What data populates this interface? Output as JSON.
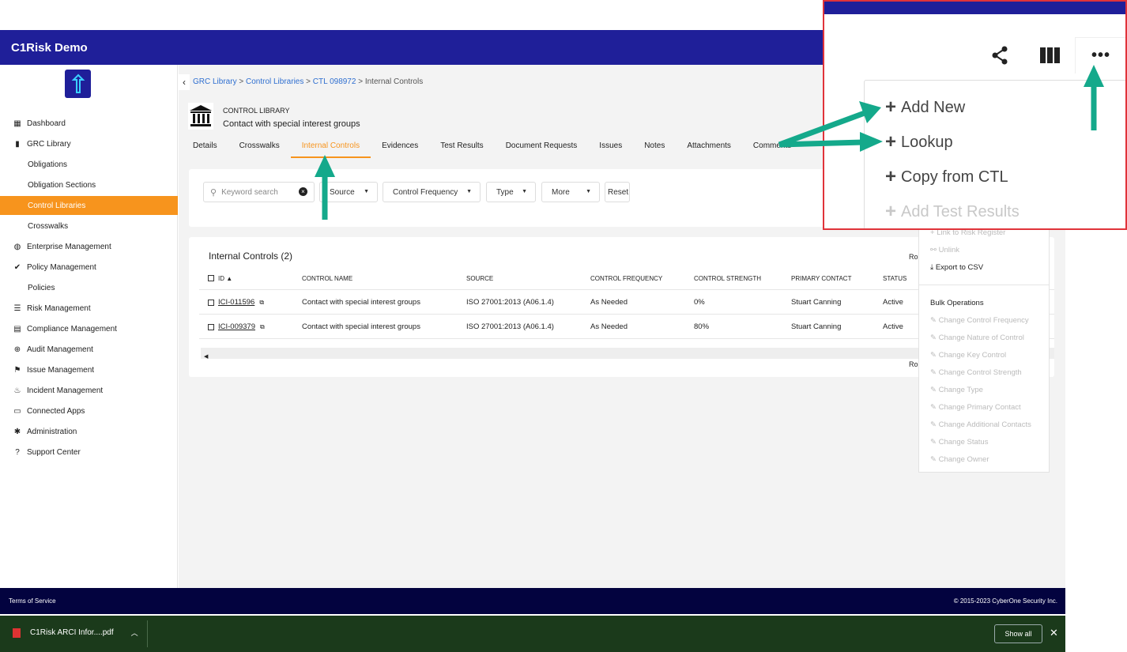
{
  "app": {
    "title": "C1Risk Demo"
  },
  "sidebar": {
    "items": [
      {
        "label": "Dashboard",
        "icon": "grid-icon"
      },
      {
        "label": "GRC Library",
        "icon": "book-icon"
      },
      {
        "label": "Obligations"
      },
      {
        "label": "Obligation Sections"
      },
      {
        "label": "Control Libraries",
        "active": true
      },
      {
        "label": "Crosswalks"
      },
      {
        "label": "Enterprise Management",
        "icon": "globe-icon"
      },
      {
        "label": "Policy Management",
        "icon": "check-icon"
      },
      {
        "label": "Policies"
      },
      {
        "label": "Risk Management",
        "icon": "list-icon"
      },
      {
        "label": "Compliance Management",
        "icon": "clipboard-icon"
      },
      {
        "label": "Audit Management",
        "icon": "target-icon"
      },
      {
        "label": "Issue Management",
        "icon": "flag-icon"
      },
      {
        "label": "Incident Management",
        "icon": "fire-icon"
      },
      {
        "label": "Connected Apps",
        "icon": "apps-icon"
      },
      {
        "label": "Administration",
        "icon": "gear-icon"
      },
      {
        "label": "Support Center",
        "icon": "help-icon"
      }
    ]
  },
  "breadcrumb": {
    "items": [
      "GRC Library",
      "Control Libraries",
      "CTL 098972"
    ],
    "current": "Internal Controls",
    "sep": ">"
  },
  "library": {
    "kind": "CONTROL LIBRARY",
    "name": "Contact with special interest groups"
  },
  "tabs": [
    "Details",
    "Crosswalks",
    "Internal Controls",
    "Evidences",
    "Test Results",
    "Document Requests",
    "Issues",
    "Notes",
    "Attachments",
    "Comments"
  ],
  "filters": {
    "search_placeholder": "Keyword search",
    "source": "Source",
    "frequency": "Control Frequency",
    "type": "Type",
    "more": "More",
    "reset": "Reset"
  },
  "grid": {
    "title": "Internal Controls (2)",
    "columns": [
      "ID",
      "CONTROL NAME",
      "SOURCE",
      "CONTROL FREQUENCY",
      "CONTROL STRENGTH",
      "PRIMARY CONTACT",
      "STATUS"
    ],
    "rows": [
      {
        "id": "ICI-011596",
        "name": "Contact with special interest groups",
        "source": "ISO 27001:2013 (A06.1.4)",
        "frequency": "As Needed",
        "strength": "0%",
        "contact": "Stuart Canning",
        "status": "Active"
      },
      {
        "id": "ICI-009379",
        "name": "Contact with special interest groups",
        "source": "ISO 27001:2013 (A06.1.4)",
        "frequency": "As Needed",
        "strength": "80%",
        "contact": "Stuart Canning",
        "status": "Active"
      }
    ],
    "rows_label": "Ro"
  },
  "actions_menu": {
    "link_risk": "Link to Risk Register",
    "unlink": "Unlink",
    "export": "Export to CSV",
    "bulk_header": "Bulk Operations",
    "bulk": [
      "Change Control Frequency",
      "Change Nature of Control",
      "Change Key Control",
      "Change Control Strength",
      "Change Type",
      "Change Primary Contact",
      "Change Additional Contacts",
      "Change Status",
      "Change Owner"
    ]
  },
  "zoom_menu": {
    "items": [
      "Add New",
      "Lookup",
      "Copy from CTL",
      "Add Test Results"
    ]
  },
  "footer": {
    "terms": "Terms of Service",
    "copyright": "© 2015-2023 CyberOne Security Inc."
  },
  "download": {
    "file": "C1Risk ARCI Infor....pdf",
    "show_all": "Show all"
  },
  "colors": {
    "brand": "#1f1f99",
    "accent": "#f7941d",
    "link": "#2f6fd0",
    "arrow": "#14a98b"
  }
}
